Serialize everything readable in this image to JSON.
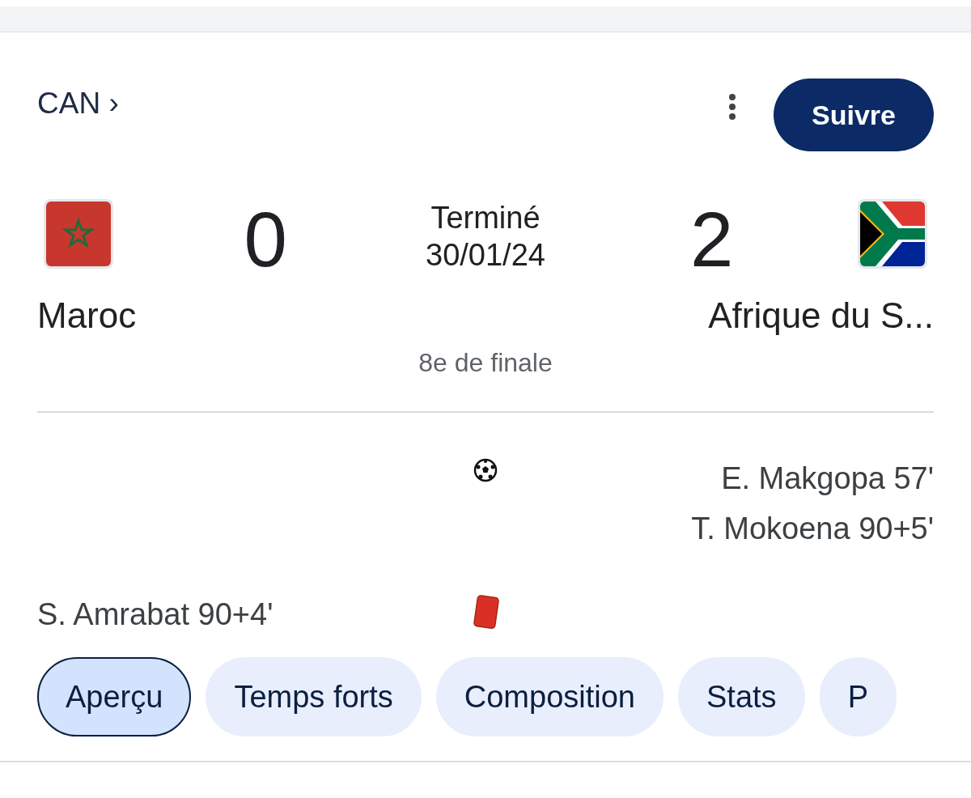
{
  "competition": {
    "label": "CAN ›"
  },
  "follow_button": {
    "label": "Suivre"
  },
  "match": {
    "status": "Terminé",
    "date": "30/01/24",
    "stage": "8e de finale",
    "home": {
      "name": "Maroc",
      "score": "0",
      "flag": {
        "kind": "morocco"
      }
    },
    "away": {
      "name": "Afrique du S...",
      "score": "2",
      "flag": {
        "kind": "south_africa"
      }
    }
  },
  "events": [
    {
      "kind": "goal",
      "away": [
        "E. Makgopa 57'",
        "T. Mokoena 90+5'"
      ]
    },
    {
      "kind": "red_card",
      "home": [
        "S. Amrabat 90+4'"
      ]
    }
  ],
  "tabs": [
    {
      "label": "Aperçu",
      "selected": true
    },
    {
      "label": "Temps forts",
      "selected": false
    },
    {
      "label": "Composition",
      "selected": false
    },
    {
      "label": "Stats",
      "selected": false
    },
    {
      "label": "P",
      "selected": false
    }
  ]
}
